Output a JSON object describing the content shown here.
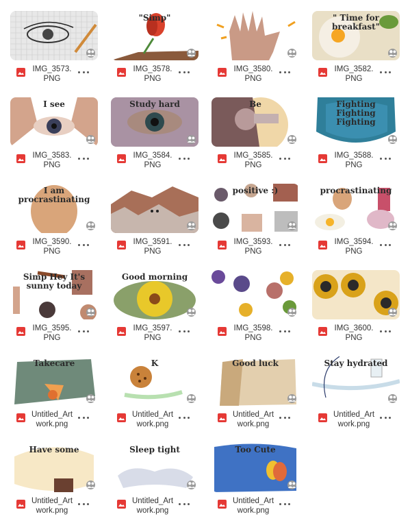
{
  "files": [
    {
      "name": "IMG_3573.PNG"
    },
    {
      "name": "IMG_3578.PNG",
      "thumb_text": "\"Simp\""
    },
    {
      "name": "IMG_3580.PNG"
    },
    {
      "name": "IMG_3582.PNG",
      "thumb_text": "\" Time for breakfast\""
    },
    {
      "name": "IMG_3583.PNG",
      "thumb_text": "I see"
    },
    {
      "name": "IMG_3584.PNG",
      "thumb_text": "Study hard"
    },
    {
      "name": "IMG_3585.PNG",
      "thumb_text": "Be"
    },
    {
      "name": "IMG_3588.PNG",
      "thumb_text": "Fighting Fighting Fighting"
    },
    {
      "name": "IMG_3590.PNG",
      "thumb_text": "I am procrastinating"
    },
    {
      "name": "IMG_3591.PNG"
    },
    {
      "name": "IMG_3593.PNG",
      "thumb_text": "positive :)"
    },
    {
      "name": "IMG_3594.PNG",
      "thumb_text": "procrastinating"
    },
    {
      "name": "IMG_3595.PNG",
      "thumb_text": "Simp  Hey  It's sunny today"
    },
    {
      "name": "IMG_3597.PNG",
      "thumb_text": "Good morning"
    },
    {
      "name": "IMG_3598.PNG"
    },
    {
      "name": "IMG_3600.PNG"
    },
    {
      "name": "Untitled_Artwork.png",
      "thumb_text": "Takecare"
    },
    {
      "name": "Untitled_Artwork.png",
      "thumb_text": "K"
    },
    {
      "name": "Untitled_Artwork.png",
      "thumb_text": "Good luck"
    },
    {
      "name": "Untitled_Artwork.png",
      "thumb_text": "Stay hydrated"
    },
    {
      "name": "Untitled_Artwork.png",
      "thumb_text": "Have some"
    },
    {
      "name": "Untitled_Artwork.png",
      "thumb_text": "Sleep tight"
    },
    {
      "name": "Untitled_Artwork.png",
      "thumb_text": "Too Cute"
    }
  ],
  "icons": {
    "file_type": "image-file-icon",
    "shared": "shared-people-icon",
    "more": "more-options-icon"
  },
  "colors": {
    "file_type_icon": "#e53935",
    "filename_text": "#333333",
    "shared_badge": "#9a9a9a"
  }
}
